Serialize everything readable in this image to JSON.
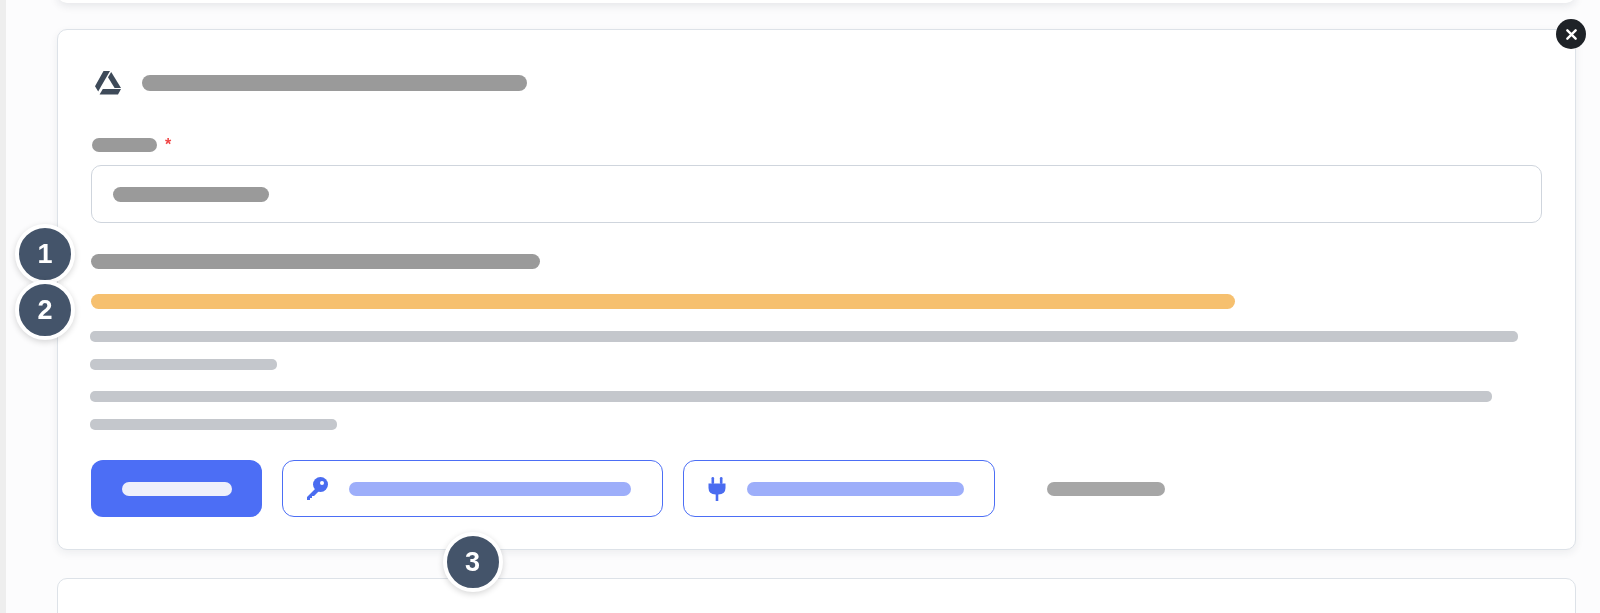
{
  "card": {
    "field": {
      "required_mark": "*"
    },
    "lines": [
      {
        "kind": "heading",
        "step": "1"
      },
      {
        "kind": "warning",
        "step": "2"
      },
      {
        "kind": "body"
      },
      {
        "kind": "body"
      }
    ],
    "actions": [
      {
        "kind": "primary"
      },
      {
        "kind": "outline",
        "step": "3"
      },
      {
        "kind": "outline"
      },
      {
        "kind": "link"
      }
    ]
  }
}
